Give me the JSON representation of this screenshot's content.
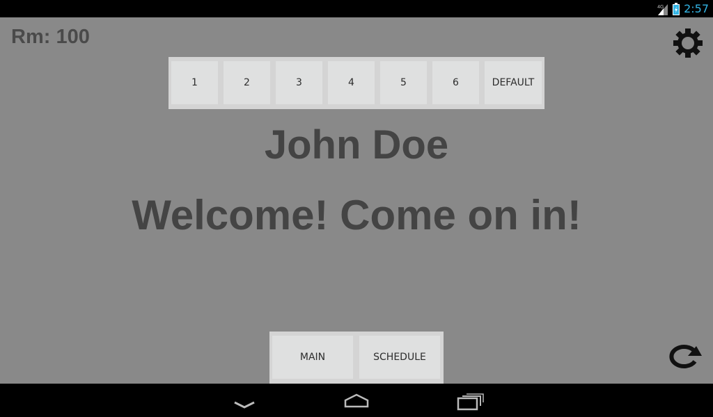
{
  "status_bar": {
    "network": "4G",
    "time": "2:57"
  },
  "header": {
    "room": "Rm: 100"
  },
  "tabs": [
    {
      "label": "1"
    },
    {
      "label": "2"
    },
    {
      "label": "3"
    },
    {
      "label": "4"
    },
    {
      "label": "5"
    },
    {
      "label": "6"
    },
    {
      "label": "DEFAULT"
    }
  ],
  "main": {
    "name": "John Doe",
    "message": "Welcome! Come on in!"
  },
  "bottom_nav": [
    {
      "label": "MAIN"
    },
    {
      "label": "SCHEDULE"
    }
  ],
  "icons": {
    "settings": "gear-icon",
    "refresh": "refresh-icon",
    "back": "back-icon",
    "home": "home-icon",
    "recents": "recents-icon"
  },
  "colors": {
    "background": "#898989",
    "tab_bar": "#d4d4d4",
    "tab": "#dfe0e0",
    "text": "#444444",
    "clock": "#33b5e5"
  }
}
